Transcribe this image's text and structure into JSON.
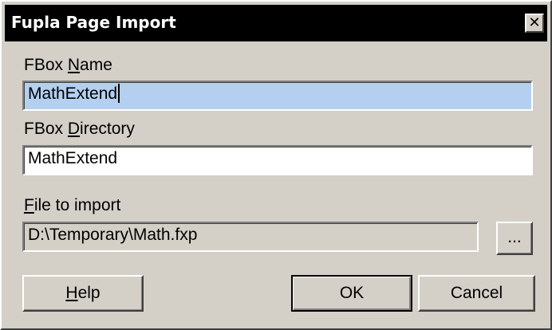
{
  "dialog": {
    "title": "Fupla Page Import",
    "close_glyph": "✕"
  },
  "fbox_name": {
    "label_prefix": "FBox ",
    "label_mnemonic": "N",
    "label_rest": "ame",
    "value": "MathExtend"
  },
  "fbox_directory": {
    "label_prefix": "FBox ",
    "label_mnemonic": "D",
    "label_rest": "irectory",
    "value": "MathExtend"
  },
  "file_to_import": {
    "label_prefix": "",
    "label_mnemonic": "F",
    "label_rest": "ile to import",
    "value": "D:\\Temporary\\Math.fxp",
    "browse_label": "..."
  },
  "buttons": {
    "help_mnemonic": "H",
    "help_rest": "elp",
    "ok": "OK",
    "cancel": "Cancel"
  },
  "colors": {
    "face": "#d4d0c8",
    "title_bar": "#000000",
    "selection": "#b4cff0"
  }
}
